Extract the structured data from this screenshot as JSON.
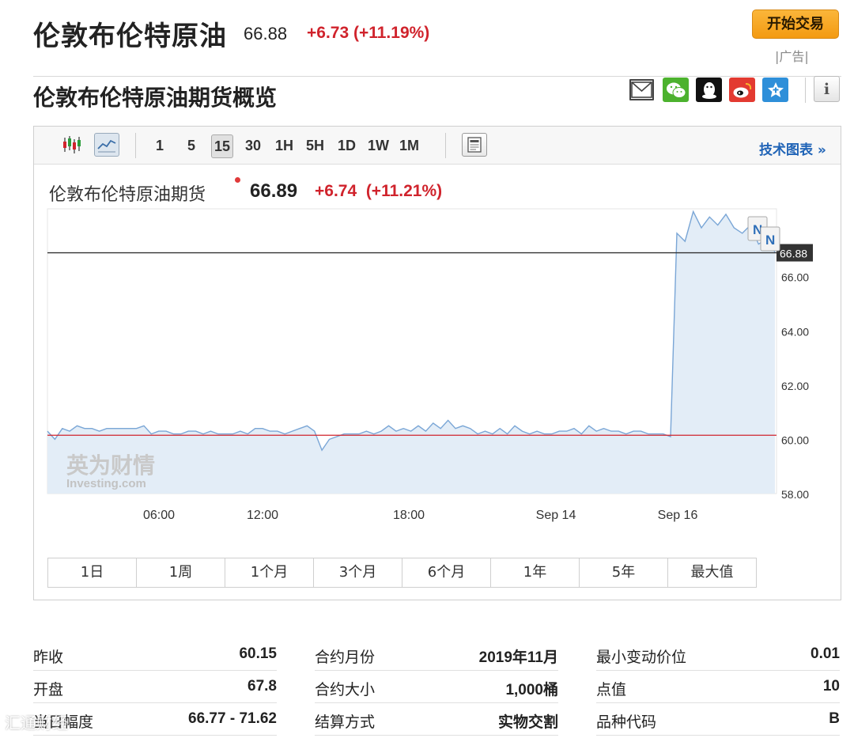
{
  "header": {
    "title": "伦敦布伦特原油",
    "price": "66.88",
    "change": "+6.73 (+11.19%)",
    "trade_button": "开始交易",
    "ad_label": "|广告|"
  },
  "overview": {
    "title": "伦敦布伦特原油期货概览",
    "share_icons": [
      "mail-icon",
      "wechat-icon",
      "qq-icon",
      "weibo-icon",
      "star-icon",
      "info-icon"
    ]
  },
  "toolbar": {
    "intervals": [
      "1",
      "5",
      "15",
      "30",
      "1H",
      "5H",
      "1D",
      "1W",
      "1M"
    ],
    "selected_interval": "15",
    "tech_chart_link": "技术图表 »"
  },
  "chart_header": {
    "name": "伦敦布伦特原油期货",
    "price": "66.89",
    "change": "+6.74",
    "change_pct": "(+11.21%)"
  },
  "chart_data": {
    "type": "area",
    "x_ticks": [
      "06:00",
      "12:00",
      "18:00",
      "Sep 14",
      "Sep 16"
    ],
    "y_ticks": [
      "58.00",
      "60.00",
      "62.00",
      "64.00",
      "66.00"
    ],
    "ylim": [
      58,
      68.5
    ],
    "current_price_label": "66.88",
    "previous_close_line": 60.15,
    "current_line": 66.88,
    "series": [
      {
        "values": [
          60.3,
          60.0,
          60.4,
          60.3,
          60.5,
          60.4,
          60.4,
          60.3,
          60.4,
          60.4,
          60.4,
          60.4,
          60.4,
          60.5,
          60.2,
          60.3,
          60.3,
          60.2,
          60.2,
          60.3,
          60.3,
          60.2,
          60.3,
          60.2,
          60.2,
          60.2,
          60.3,
          60.2,
          60.4,
          60.4,
          60.3,
          60.3,
          60.2,
          60.3,
          60.4,
          60.5,
          60.3,
          59.6,
          60.0,
          60.1,
          60.2,
          60.2,
          60.2,
          60.3,
          60.2,
          60.3,
          60.5,
          60.3,
          60.4,
          60.3,
          60.5,
          60.3,
          60.6,
          60.4,
          60.7,
          60.4,
          60.5,
          60.4,
          60.2,
          60.3,
          60.2,
          60.4,
          60.2,
          60.5,
          60.3,
          60.2,
          60.3,
          60.2,
          60.2,
          60.3,
          60.3,
          60.4,
          60.2,
          60.5,
          60.3,
          60.4,
          60.3,
          60.3,
          60.2,
          60.3,
          60.3,
          60.2,
          60.2,
          60.2,
          60.1,
          67.6,
          67.3,
          68.4,
          67.8,
          68.2,
          67.9,
          68.3,
          67.8,
          67.6,
          67.9,
          67.2,
          67.4,
          66.9
        ]
      }
    ],
    "annotations": [
      "N",
      "N"
    ]
  },
  "watermark": {
    "brand_cn": "英为财情",
    "brand_en": "Investing.com"
  },
  "ranges": [
    "1日",
    "1周",
    "1个月",
    "3个月",
    "6个月",
    "1年",
    "5年",
    "最大值"
  ],
  "stats": [
    [
      {
        "label": "昨收",
        "value": "60.15"
      },
      {
        "label": "开盘",
        "value": "67.8"
      },
      {
        "label": "当日幅度",
        "value": "66.77 - 71.62"
      }
    ],
    [
      {
        "label": "合约月份",
        "value": "2019年11月"
      },
      {
        "label": "合约大小",
        "value": "1,000桶"
      },
      {
        "label": "结算方式",
        "value": "实物交割"
      }
    ],
    [
      {
        "label": "最小变动价位",
        "value": "0.01"
      },
      {
        "label": "点值",
        "value": "10"
      },
      {
        "label": "品种代码",
        "value": "B"
      }
    ]
  ],
  "corner_watermark": "汇通财经",
  "colors": {
    "accent_red": "#d0232c",
    "link_blue": "#1f63b6",
    "area_fill": "#e3edf7",
    "line_blue": "#7aa6d6"
  }
}
